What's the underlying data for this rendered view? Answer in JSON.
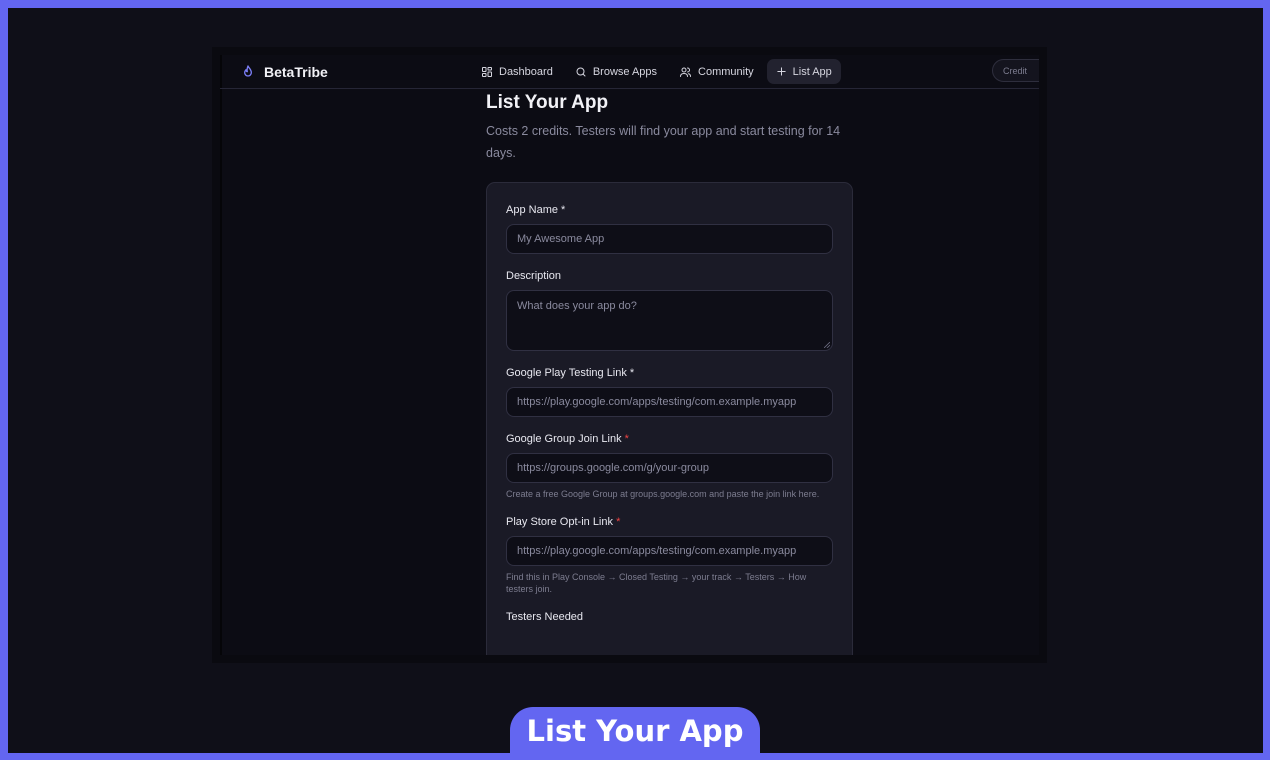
{
  "brand": {
    "name": "BetaTribe",
    "icon": "flame-icon",
    "accent": "#6366f1"
  },
  "nav": [
    {
      "label": "Dashboard",
      "icon": "grid-icon"
    },
    {
      "label": "Browse Apps",
      "icon": "search-icon"
    },
    {
      "label": "Community",
      "icon": "users-icon"
    },
    {
      "label": "List App",
      "icon": "plus-icon",
      "active": true
    }
  ],
  "credits_label": "Credit",
  "page": {
    "title": "List Your App",
    "subtitle": "Costs 2 credits. Testers will find your app and start testing for 14 days."
  },
  "form": {
    "app_name": {
      "label": "App Name *",
      "placeholder": "My Awesome App"
    },
    "description": {
      "label": "Description",
      "placeholder": "What does your app do?"
    },
    "play_testing_link": {
      "label": "Google Play Testing Link *",
      "placeholder": "https://play.google.com/apps/testing/com.example.myapp"
    },
    "group_link": {
      "label": "Google Group Join Link",
      "required_mark": "*",
      "placeholder": "https://groups.google.com/g/your-group",
      "hint": "Create a free Google Group at groups.google.com and paste the join link here."
    },
    "optin_link": {
      "label": "Play Store Opt-in Link",
      "required_mark": "*",
      "placeholder": "https://play.google.com/apps/testing/com.example.myapp",
      "hint": "Find this in Play Console → Closed Testing → your track → Testers → How testers join."
    },
    "testers_needed": {
      "label": "Testers Needed"
    }
  },
  "banner": {
    "label": "List Your App",
    "color": "#6366f1"
  }
}
